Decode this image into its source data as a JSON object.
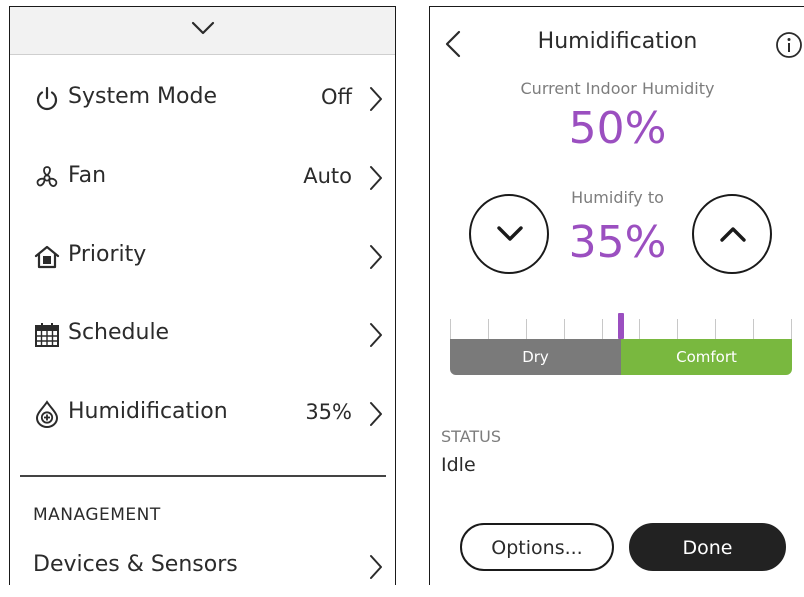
{
  "colors": {
    "accent_purple": "#9b4fc0",
    "dry_gray": "#7a7a7a",
    "comfort_green": "#79b83f",
    "done_dark": "#222222"
  },
  "menu": {
    "collapse_icon": "chevron-down-icon",
    "items": [
      {
        "icon": "power-icon",
        "label": "System Mode",
        "value": "Off"
      },
      {
        "icon": "fan-icon",
        "label": "Fan",
        "value": "Auto"
      },
      {
        "icon": "priority-home-icon",
        "label": "Priority",
        "value": ""
      },
      {
        "icon": "calendar-icon",
        "label": "Schedule",
        "value": ""
      },
      {
        "icon": "humidity-drop-icon",
        "label": "Humidification",
        "value": "35%"
      }
    ],
    "section_label": "MANAGEMENT",
    "devices_label": "Devices & Sensors"
  },
  "humidification": {
    "title": "Humidification",
    "current_label": "Current Indoor Humidity",
    "current_value": "50%",
    "humidify_label": "Humidify to",
    "humidify_value": "35%",
    "scale_marker_fraction": 0.5,
    "dry_label": "Dry",
    "comfort_label": "Comfort",
    "status_label": "STATUS",
    "status_value": "Idle",
    "options_label": "Options...",
    "done_label": "Done"
  }
}
